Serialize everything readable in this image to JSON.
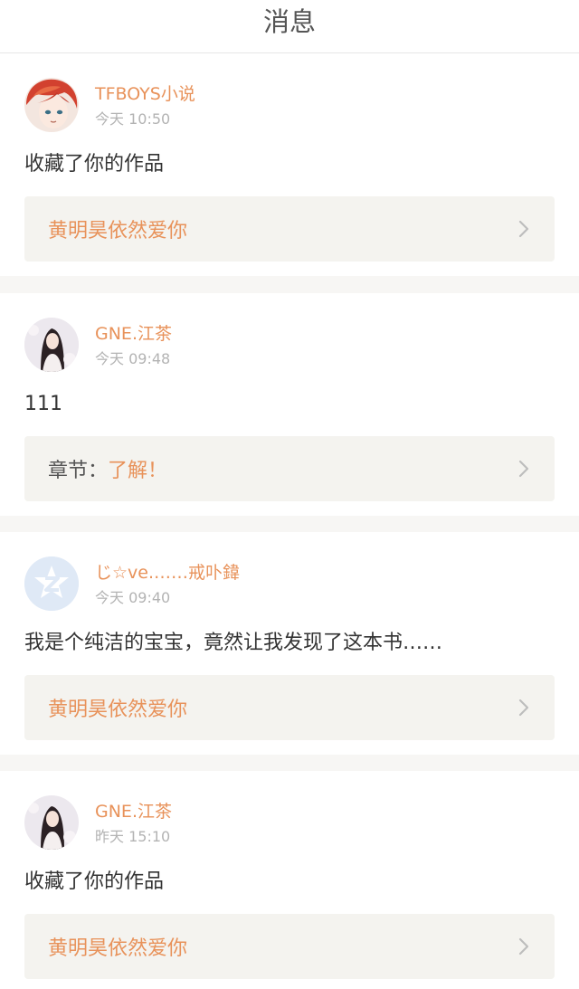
{
  "header": {
    "title": "消息"
  },
  "notifications": [
    {
      "username": "TFBOYS小说",
      "time": "今天 10:50",
      "message": "收藏了你的作品",
      "link_prefix": "",
      "link_text": "黄明昊依然爱你",
      "avatar_icon": "anime-boy-avatar"
    },
    {
      "username": "GNE.江茶",
      "time": "今天 09:48",
      "message": "111",
      "link_prefix": "章节：",
      "link_text": "了解！",
      "avatar_icon": "girl-portrait-avatar"
    },
    {
      "username": "じ☆ve.……戒卟鍏",
      "time": "今天 09:40",
      "message": "我是个纯洁的宝宝，竟然让我发现了这本书……",
      "link_prefix": "",
      "link_text": "黄明昊依然爱你",
      "avatar_icon": "qzone-default-avatar"
    },
    {
      "username": "GNE.江茶",
      "time": "昨天 15:10",
      "message": "收藏了你的作品",
      "link_prefix": "",
      "link_text": "黄明昊依然爱你",
      "avatar_icon": "girl-portrait-avatar"
    }
  ],
  "colors": {
    "accent": "#e8925a",
    "background": "#f7f6f4",
    "link_box": "#f4f3ef",
    "text": "#333333",
    "muted": "#b3b3b3"
  }
}
